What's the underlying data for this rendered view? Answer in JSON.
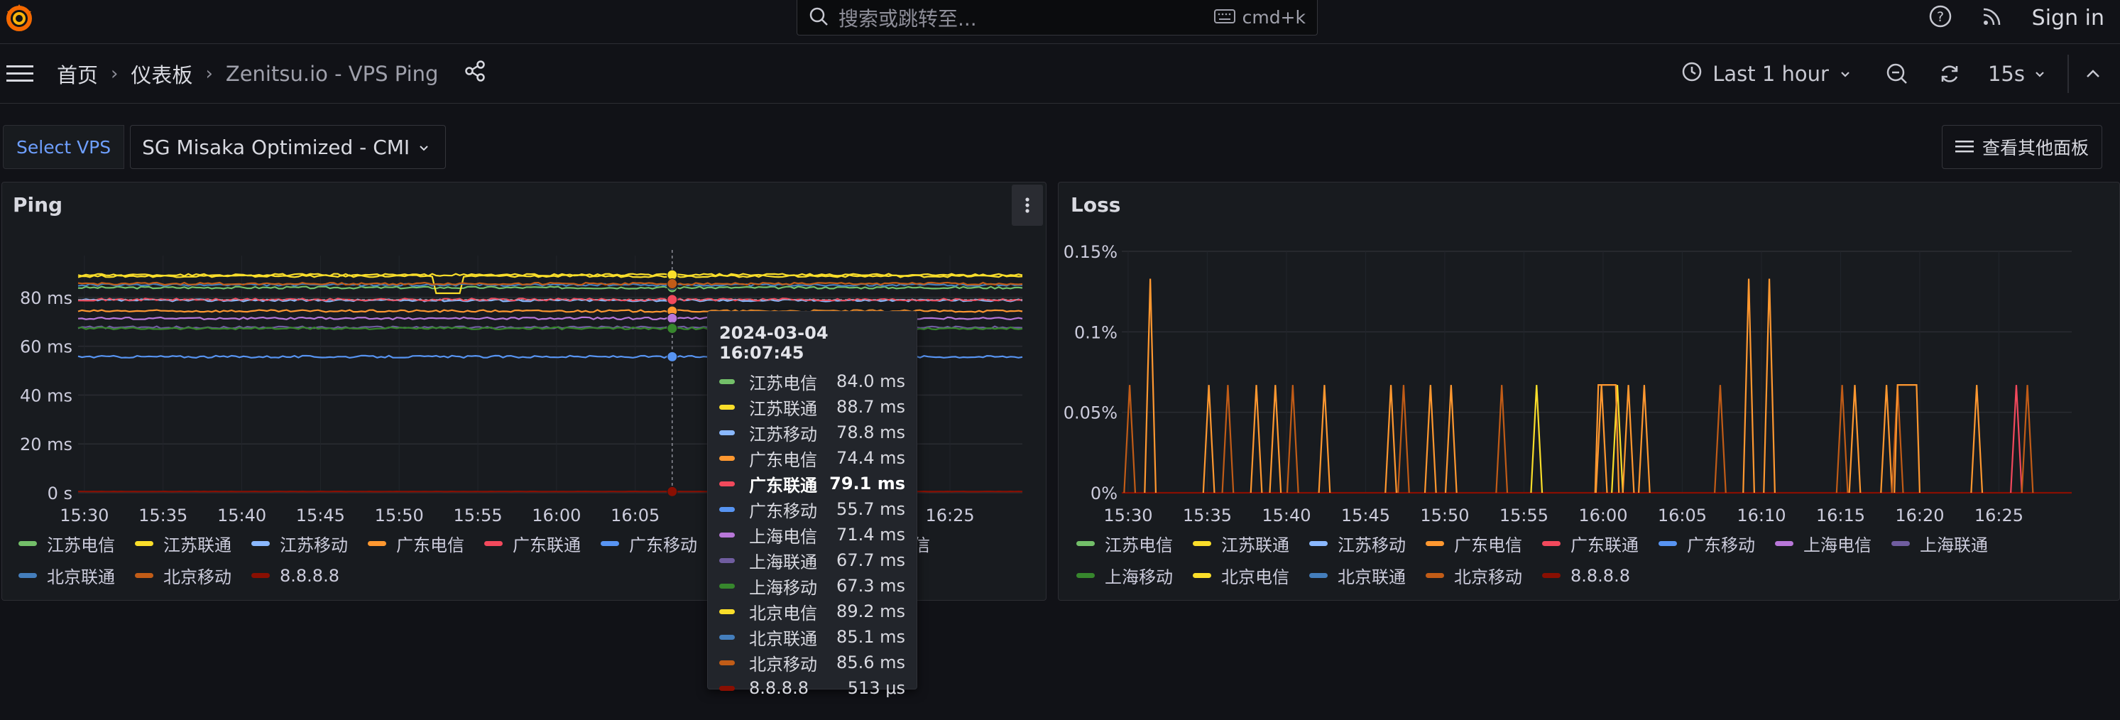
{
  "header": {
    "search_placeholder": "搜索或跳转至...",
    "shortcut": "cmd+k",
    "sign_in": "Sign in"
  },
  "breadcrumb": {
    "home": "首页",
    "dashboards": "仪表板",
    "current": "Zenitsu.io - VPS Ping"
  },
  "toolbar": {
    "time_range": "Last 1 hour",
    "refresh_interval": "15s"
  },
  "variables": {
    "label": "Select VPS",
    "value": "SG Misaka Optimized - CMI"
  },
  "other_panels_button": "查看其他面板",
  "series": [
    {
      "name": "江苏电信",
      "color": "#73bf69"
    },
    {
      "name": "江苏联通",
      "color": "#fade2a"
    },
    {
      "name": "江苏移动",
      "color": "#8ab8ff"
    },
    {
      "name": "广东电信",
      "color": "#ff9830"
    },
    {
      "name": "广东联通",
      "color": "#f2495c"
    },
    {
      "name": "广东移动",
      "color": "#5794f2"
    },
    {
      "name": "上海电信",
      "color": "#b877d9"
    },
    {
      "name": "上海联通",
      "color": "#705da0"
    },
    {
      "name": "上海移动",
      "color": "#37872d"
    },
    {
      "name": "北京电信",
      "color": "#fade2a"
    },
    {
      "name": "北京联通",
      "color": "#447ebc"
    },
    {
      "name": "北京移动",
      "color": "#c15c17"
    },
    {
      "name": "8.8.8.8",
      "color": "#890f02"
    }
  ],
  "ping_panel": {
    "title": "Ping",
    "legend": [
      "江苏电信",
      "江苏联通",
      "江苏移动",
      "广东电信",
      "广东联通",
      "广东移动",
      "上海移动",
      "北京电信",
      "北京联通",
      "北京移动",
      "8.8.8.8"
    ]
  },
  "loss_panel": {
    "title": "Loss",
    "legend": [
      "江苏电信",
      "江苏联通",
      "江苏移动",
      "广东电信",
      "广东联通",
      "广东移动",
      "上海电信",
      "上海联通",
      "上海移动",
      "北京电信",
      "北京联通",
      "北京移动",
      "8.8.8.8"
    ]
  },
  "tooltip": {
    "time": "2024-03-04 16:07:45",
    "rows": [
      {
        "name": "江苏电信",
        "value": "84.0 ms",
        "color": "#73bf69",
        "highlight": false
      },
      {
        "name": "江苏联通",
        "value": "88.7 ms",
        "color": "#fade2a",
        "highlight": false
      },
      {
        "name": "江苏移动",
        "value": "78.8 ms",
        "color": "#8ab8ff",
        "highlight": false
      },
      {
        "name": "广东电信",
        "value": "74.4 ms",
        "color": "#ff9830",
        "highlight": false
      },
      {
        "name": "广东联通",
        "value": "79.1 ms",
        "color": "#f2495c",
        "highlight": true
      },
      {
        "name": "广东移动",
        "value": "55.7 ms",
        "color": "#5794f2",
        "highlight": false
      },
      {
        "name": "上海电信",
        "value": "71.4 ms",
        "color": "#b877d9",
        "highlight": false
      },
      {
        "name": "上海联通",
        "value": "67.7 ms",
        "color": "#705da0",
        "highlight": false
      },
      {
        "name": "上海移动",
        "value": "67.3 ms",
        "color": "#37872d",
        "highlight": false
      },
      {
        "name": "北京电信",
        "value": "89.2 ms",
        "color": "#fade2a",
        "highlight": false
      },
      {
        "name": "北京联通",
        "value": "85.1 ms",
        "color": "#447ebc",
        "highlight": false
      },
      {
        "name": "北京移动",
        "value": "85.6 ms",
        "color": "#c15c17",
        "highlight": false
      },
      {
        "name": "8.8.8.8",
        "value": "513 μs",
        "color": "#890f02",
        "highlight": false
      }
    ]
  },
  "chart_data": [
    {
      "type": "line",
      "title": "Ping",
      "y_ticks": [
        "0 s",
        "20 ms",
        "40 ms",
        "60 ms",
        "80 ms"
      ],
      "ylim": [
        0,
        100
      ],
      "x_ticks": [
        "15:30",
        "15:35",
        "15:40",
        "15:45",
        "15:50",
        "15:55",
        "16:00",
        "16:05",
        "16:10",
        "16:15",
        "16:20",
        "16:25"
      ],
      "series": [
        {
          "name": "江苏电信",
          "value": 84.0
        },
        {
          "name": "江苏联通",
          "value": 88.7
        },
        {
          "name": "江苏移动",
          "value": 78.8
        },
        {
          "name": "广东电信",
          "value": 74.4
        },
        {
          "name": "广东联通",
          "value": 79.1
        },
        {
          "name": "广东移动",
          "value": 55.7
        },
        {
          "name": "上海电信",
          "value": 71.4
        },
        {
          "name": "上海联通",
          "value": 67.7
        },
        {
          "name": "上海移动",
          "value": 67.3
        },
        {
          "name": "北京电信",
          "value": 89.2
        },
        {
          "name": "北京联通",
          "value": 85.1
        },
        {
          "name": "北京移动",
          "value": 85.6
        },
        {
          "name": "8.8.8.8",
          "value": 0.513
        }
      ]
    },
    {
      "type": "line",
      "title": "Loss",
      "y_ticks": [
        "0%",
        "0.05%",
        "0.1%",
        "0.15%"
      ],
      "ylim": [
        0,
        0.15
      ],
      "x_ticks": [
        "15:30",
        "15:35",
        "15:40",
        "15:45",
        "15:50",
        "15:55",
        "16:00",
        "16:05",
        "16:10",
        "16:15",
        "16:20",
        "16:25"
      ],
      "spikes": [
        {
          "t": 0.5,
          "v": 0.067
        },
        {
          "t": 1.8,
          "v": 0.133
        },
        {
          "t": 5.5,
          "v": 0.067
        },
        {
          "t": 6.7,
          "v": 0.067
        },
        {
          "t": 8.5,
          "v": 0.067
        },
        {
          "t": 9.7,
          "v": 0.067
        },
        {
          "t": 10.8,
          "v": 0.067
        },
        {
          "t": 12.8,
          "v": 0.067
        },
        {
          "t": 17.0,
          "v": 0.067
        },
        {
          "t": 17.8,
          "v": 0.067
        },
        {
          "t": 19.5,
          "v": 0.067
        },
        {
          "t": 20.8,
          "v": 0.067
        },
        {
          "t": 24.0,
          "v": 0.067
        },
        {
          "t": 26.2,
          "v": 0.067
        },
        {
          "t": 30.3,
          "v": 0.067
        },
        {
          "t": 31.3,
          "v": 0.067
        },
        {
          "t": 32.0,
          "v": 0.067
        },
        {
          "t": 33.0,
          "v": 0.067
        },
        {
          "t": 37.8,
          "v": 0.067
        },
        {
          "t": 39.6,
          "v": 0.133
        },
        {
          "t": 40.9,
          "v": 0.133
        },
        {
          "t": 45.5,
          "v": 0.067
        },
        {
          "t": 46.3,
          "v": 0.067
        },
        {
          "t": 48.3,
          "v": 0.067
        },
        {
          "t": 49.0,
          "v": 0.067
        },
        {
          "t": 54.0,
          "v": 0.067
        },
        {
          "t": 56.5,
          "v": 0.067
        },
        {
          "t": 57.2,
          "v": 0.067
        }
      ],
      "series": [
        "江苏电信",
        "江苏联通",
        "江苏移动",
        "广东电信",
        "广东联通",
        "广东移动",
        "上海电信",
        "上海联通",
        "上海移动",
        "北京电信",
        "北京联通",
        "北京移动",
        "8.8.8.8"
      ]
    }
  ]
}
